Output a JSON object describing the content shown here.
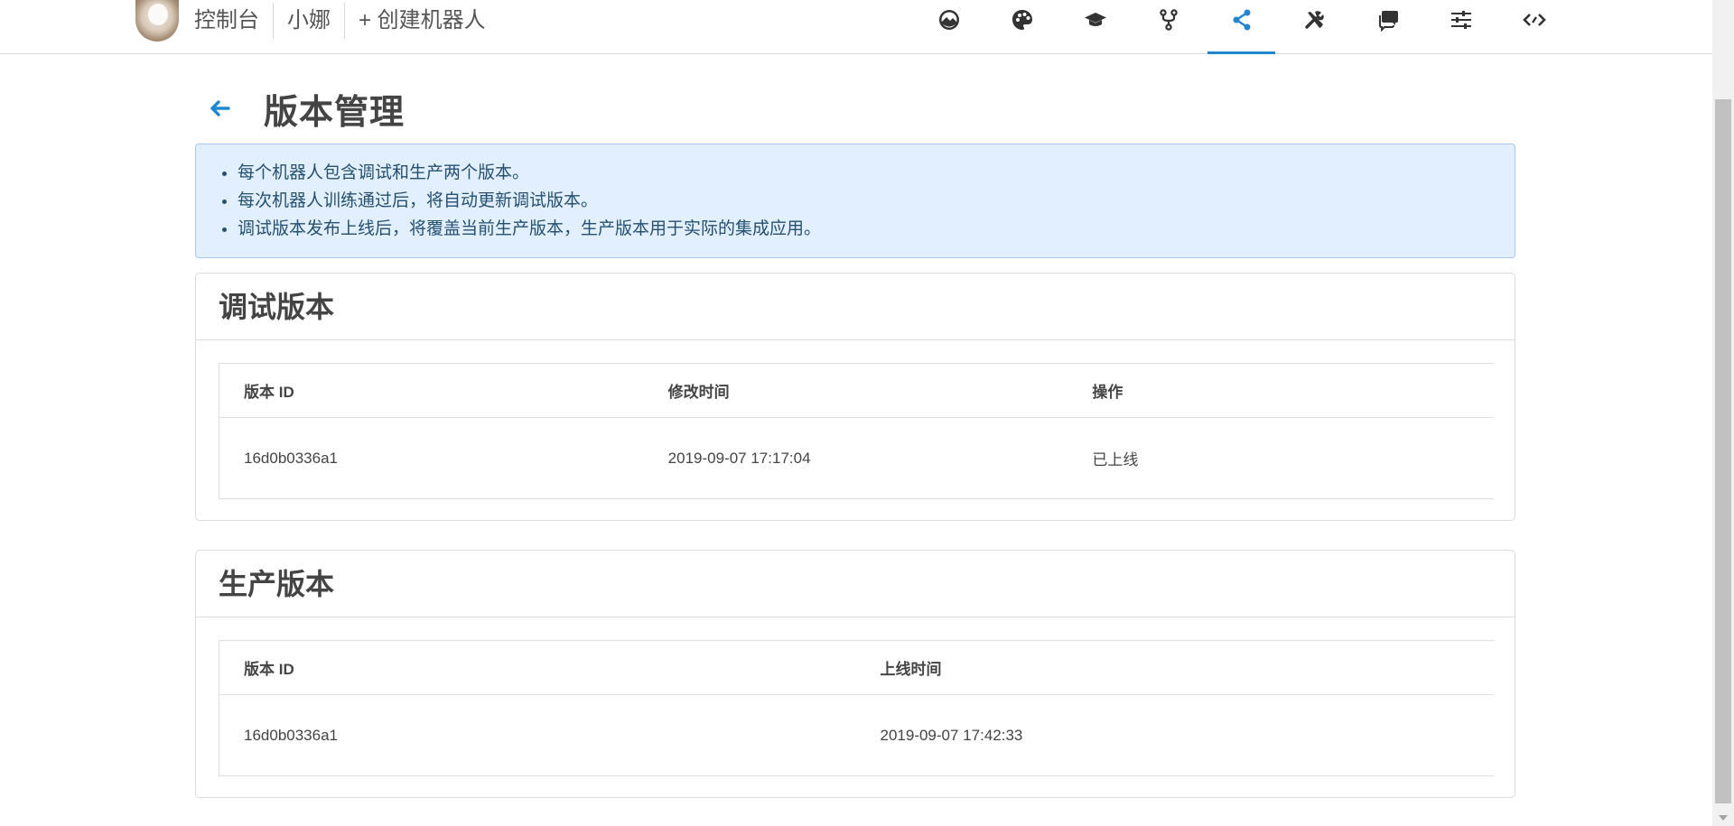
{
  "nav": {
    "crumbs": [
      "控制台",
      "小娜",
      "+ 创建机器人"
    ],
    "active_color": "#2185d0",
    "icons": [
      "landscape-icon",
      "palette-icon",
      "graduation-cap-icon",
      "code-fork-icon",
      "share-icon",
      "tools-icon",
      "comments-icon",
      "sliders-icon",
      "code-icon"
    ],
    "active_index": 4
  },
  "page": {
    "title": "版本管理"
  },
  "info": {
    "items": [
      "每个机器人包含调试和生产两个版本。",
      "每次机器人训练通过后，将自动更新调试版本。",
      "调试版本发布上线后，将覆盖当前生产版本，生产版本用于实际的集成应用。"
    ]
  },
  "debug": {
    "title": "调试版本",
    "headers": [
      "版本 ID",
      "修改时间",
      "操作"
    ],
    "rows": [
      [
        "16d0b0336a1",
        "2019-09-07 17:17:04",
        "已上线"
      ]
    ]
  },
  "production": {
    "title": "生产版本",
    "headers": [
      "版本 ID",
      "上线时间"
    ],
    "rows": [
      [
        "16d0b0336a1",
        "2019-09-07 17:42:33"
      ]
    ]
  }
}
